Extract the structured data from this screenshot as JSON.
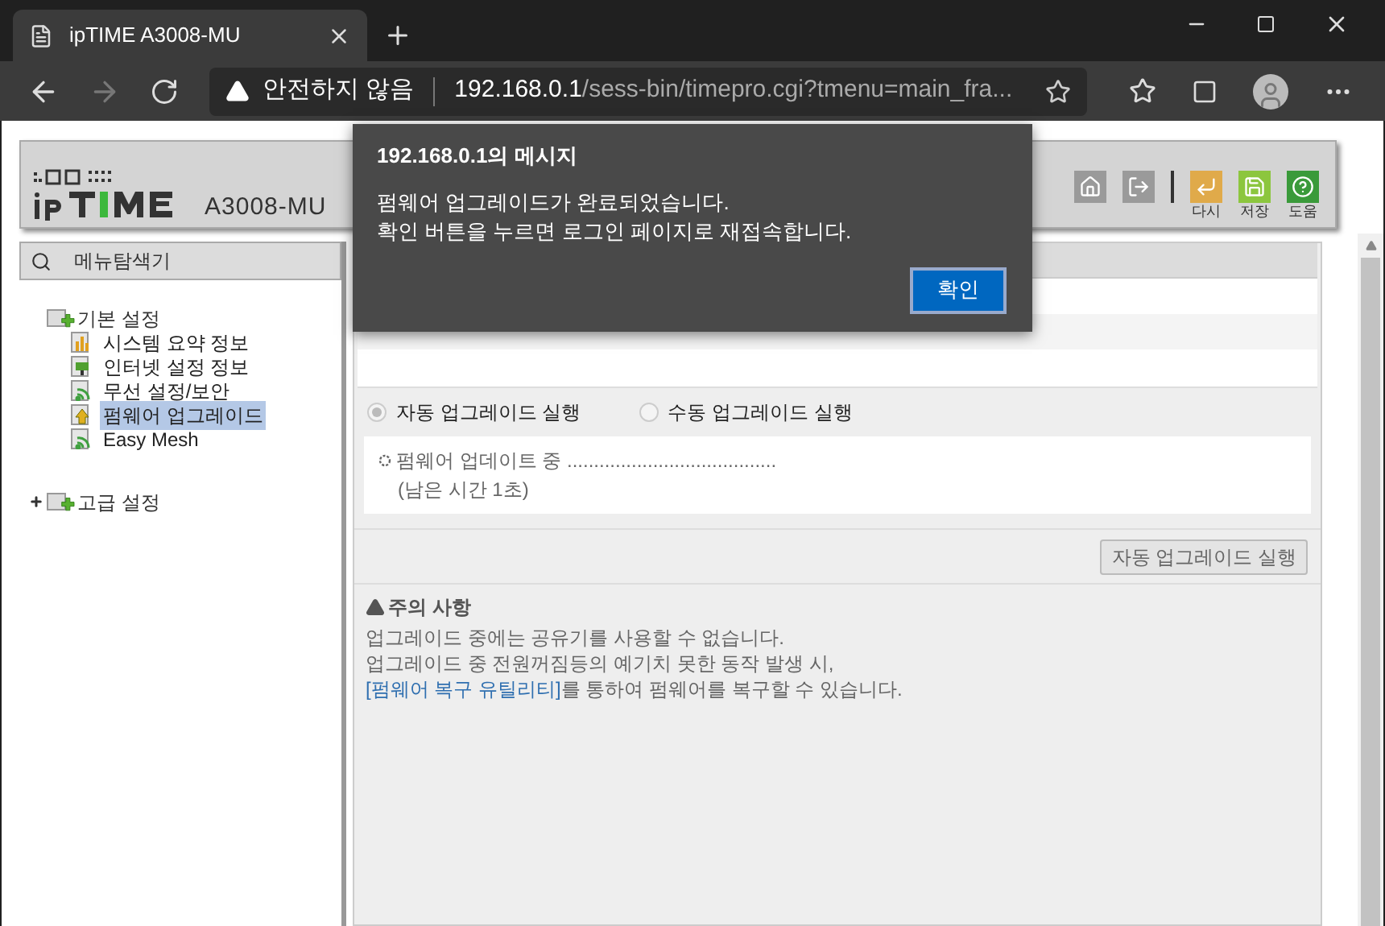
{
  "browser": {
    "tab": {
      "title": "ipTIME A3008-MU"
    },
    "security": "안전하지 않음",
    "url_host": "192.168.0.1",
    "url_path": "/sess-bin/timepro.cgi?tmenu=main_fra..."
  },
  "header": {
    "logo_model": "A3008-MU",
    "tools": [
      {
        "kind": "home"
      },
      {
        "kind": "logout"
      },
      {
        "kind": "reset",
        "label": "다시"
      },
      {
        "kind": "save",
        "label": "저장"
      },
      {
        "kind": "help",
        "label": "도움"
      }
    ]
  },
  "sidebar": {
    "title": "메뉴탐색기",
    "tree": [
      {
        "label": "기본 설정",
        "expanded": true,
        "children": [
          {
            "label": "시스템 요약 정보",
            "kind": "chart",
            "selected": false
          },
          {
            "label": "인터넷 설정 정보",
            "kind": "monitor",
            "selected": false
          },
          {
            "label": "무선 설정/보안",
            "kind": "wireless",
            "selected": false
          },
          {
            "label": "펌웨어 업그레이드",
            "kind": "upgrade",
            "selected": true
          },
          {
            "label": "Easy Mesh",
            "kind": "wireless",
            "selected": false
          }
        ]
      },
      {
        "label": "고급 설정",
        "expanded": false
      }
    ]
  },
  "modes": [
    {
      "label": "자동 업그레이드 실행",
      "selected": true,
      "disabled": true
    },
    {
      "label": "수동 업그레이드 실행",
      "selected": false,
      "disabled": true
    }
  ],
  "progress": {
    "line1": "펌웨어 업데이트 중 .......................................",
    "line2": "(남은 시간 1초)"
  },
  "run_button": {
    "label": "자동 업그레이드 실행",
    "disabled": true
  },
  "notes": {
    "title": "주의 사항",
    "lines": [
      "업그레이드 중에는 공유기를 사용할 수 없습니다.",
      "업그레이드 중 전원꺼짐등의 예기치 못한 동작 발생 시,"
    ],
    "link": "[펌웨어 복구 유틸리티]",
    "link_tail": "를 통하여 펌웨어를 복구할 수 있습니다."
  },
  "dialog": {
    "title": "192.168.0.1의 메시지",
    "lines": [
      "펌웨어 업그레이드가 완료되었습니다.",
      "확인 버튼을 누르면 로그인 페이지로 재접속합니다."
    ],
    "button": "확인"
  }
}
